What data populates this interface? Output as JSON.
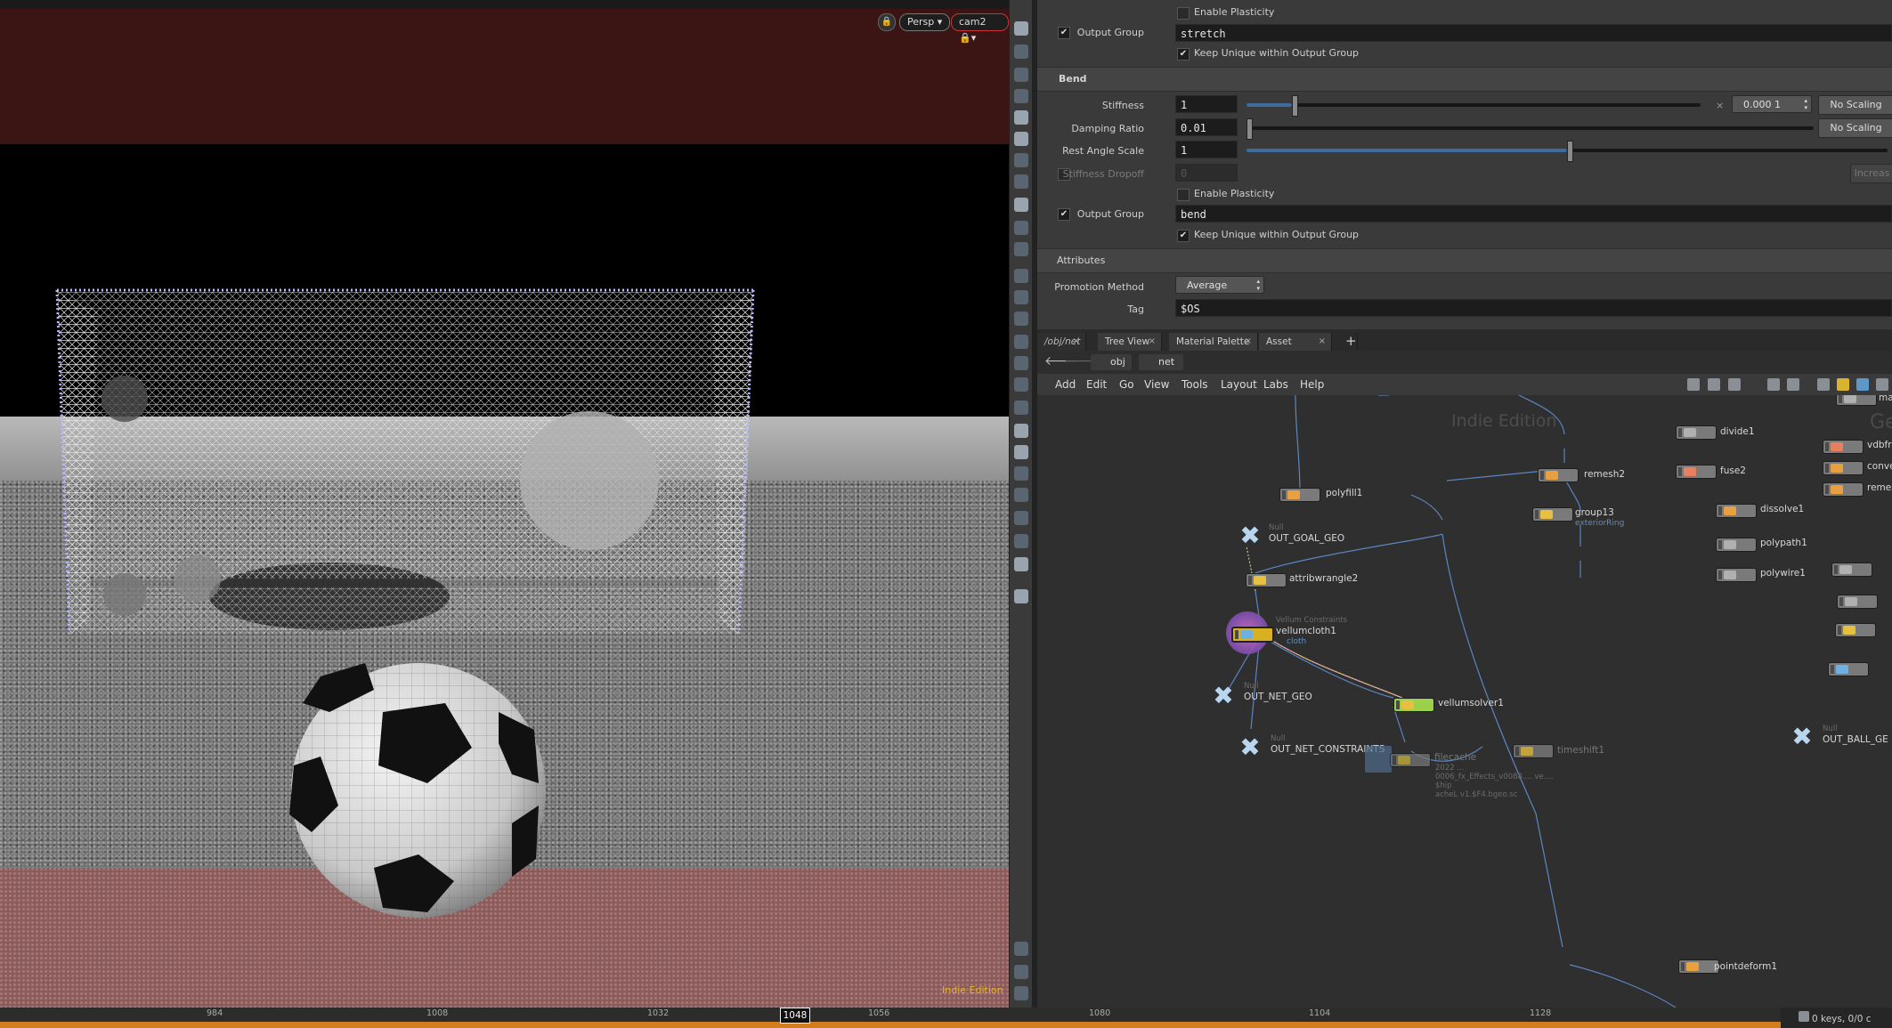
{
  "viewport": {
    "view_label": "Persp ▾",
    "camera_label": "cam2 🔒▾",
    "watermark": "Indie Edition"
  },
  "params": {
    "stretch_block": {
      "enable_plasticity": "Enable Plasticity",
      "output_group_label": "Output Group",
      "output_group_value": "stretch",
      "keep_unique": "Keep Unique within Output Group"
    },
    "bend_section": "Bend",
    "stiffness": {
      "label": "Stiffness",
      "value": "1",
      "multiplier_sign": "×",
      "multiplier": "0.000 1",
      "scaling": "No Scaling",
      "slider_fraction": 0.1
    },
    "damping": {
      "label": "Damping Ratio",
      "value": "0.01",
      "scaling": "No Scaling",
      "slider_fraction": 0.0
    },
    "rest_angle": {
      "label": "Rest Angle Scale",
      "value": "1",
      "slider_fraction": 0.5
    },
    "stiffness_dropoff": {
      "label": "Stiffness Dropoff",
      "value": "0",
      "button": "Increas"
    },
    "bend_block": {
      "enable_plasticity": "Enable Plasticity",
      "output_group_label": "Output Group",
      "output_group_value": "bend",
      "keep_unique": "Keep Unique within Output Group"
    },
    "attributes_section": "Attributes",
    "promotion": {
      "label": "Promotion Method",
      "value": "Average"
    },
    "tag": {
      "label": "Tag",
      "value": "$OS"
    }
  },
  "network": {
    "tabs": [
      "/obj/net",
      "Tree View",
      "Material Palette",
      "Asset Browser"
    ],
    "add_tab": "+",
    "path": [
      "obj",
      "net"
    ],
    "menu": [
      "Add",
      "Edit",
      "Go",
      "View",
      "Tools",
      "Layout",
      "Labs",
      "Help"
    ],
    "watermark": "Indie Edition",
    "nodes": {
      "polyfill1": "polyfill1",
      "out_goal_geo": "OUT_GOAL_GEO",
      "null_type": "Null",
      "attribwrangle2": "attribwrangle2",
      "vellumcloth1": "vellumcloth1",
      "vellumcloth1_type": "Vellum Constraints",
      "vellumcloth1_sub": "cloth",
      "out_net_geo": "OUT_NET_GEO",
      "vellumsolver1": "vellumsolver1",
      "out_net_constraints": "OUT_NET_CONSTRAINTS",
      "filecache": "filecache",
      "filecache_path": "2022 ... 0006_fx_Effects_v0088.... ve.... $hip\nacheL v1.$F4.bgeo.sc",
      "timeshift1": "timeshift1",
      "remesh2": "remesh2",
      "group13": "group13",
      "group13_sub": "exteriorRing",
      "divide1": "divide1",
      "fuse2": "fuse2",
      "dissolve1": "dissolve1",
      "polypath1": "polypath1",
      "polywire1": "polywire1",
      "pointdeform1": "pointdeform1",
      "out_ball_geo": "OUT_BALL_GE",
      "geo_label": "Geo",
      "right_vdbfro": "vdbfro",
      "right_conver": "conver",
      "right_remes": "remes",
      "right_ma": "ma"
    }
  },
  "timeline": {
    "ticks": [
      "984",
      "1008",
      "1032",
      "1056",
      "1080",
      "1104",
      "1128"
    ],
    "current_frame": "1048",
    "keys": "0 keys, 0/0 c"
  },
  "colors": {
    "accent_orange": "#d47d1e",
    "slider_blue": "#3e6c9c",
    "viewport_red_band": "#3b1414",
    "floor_red": "#8d5a5a",
    "wire_blue": "#5a86c0"
  }
}
